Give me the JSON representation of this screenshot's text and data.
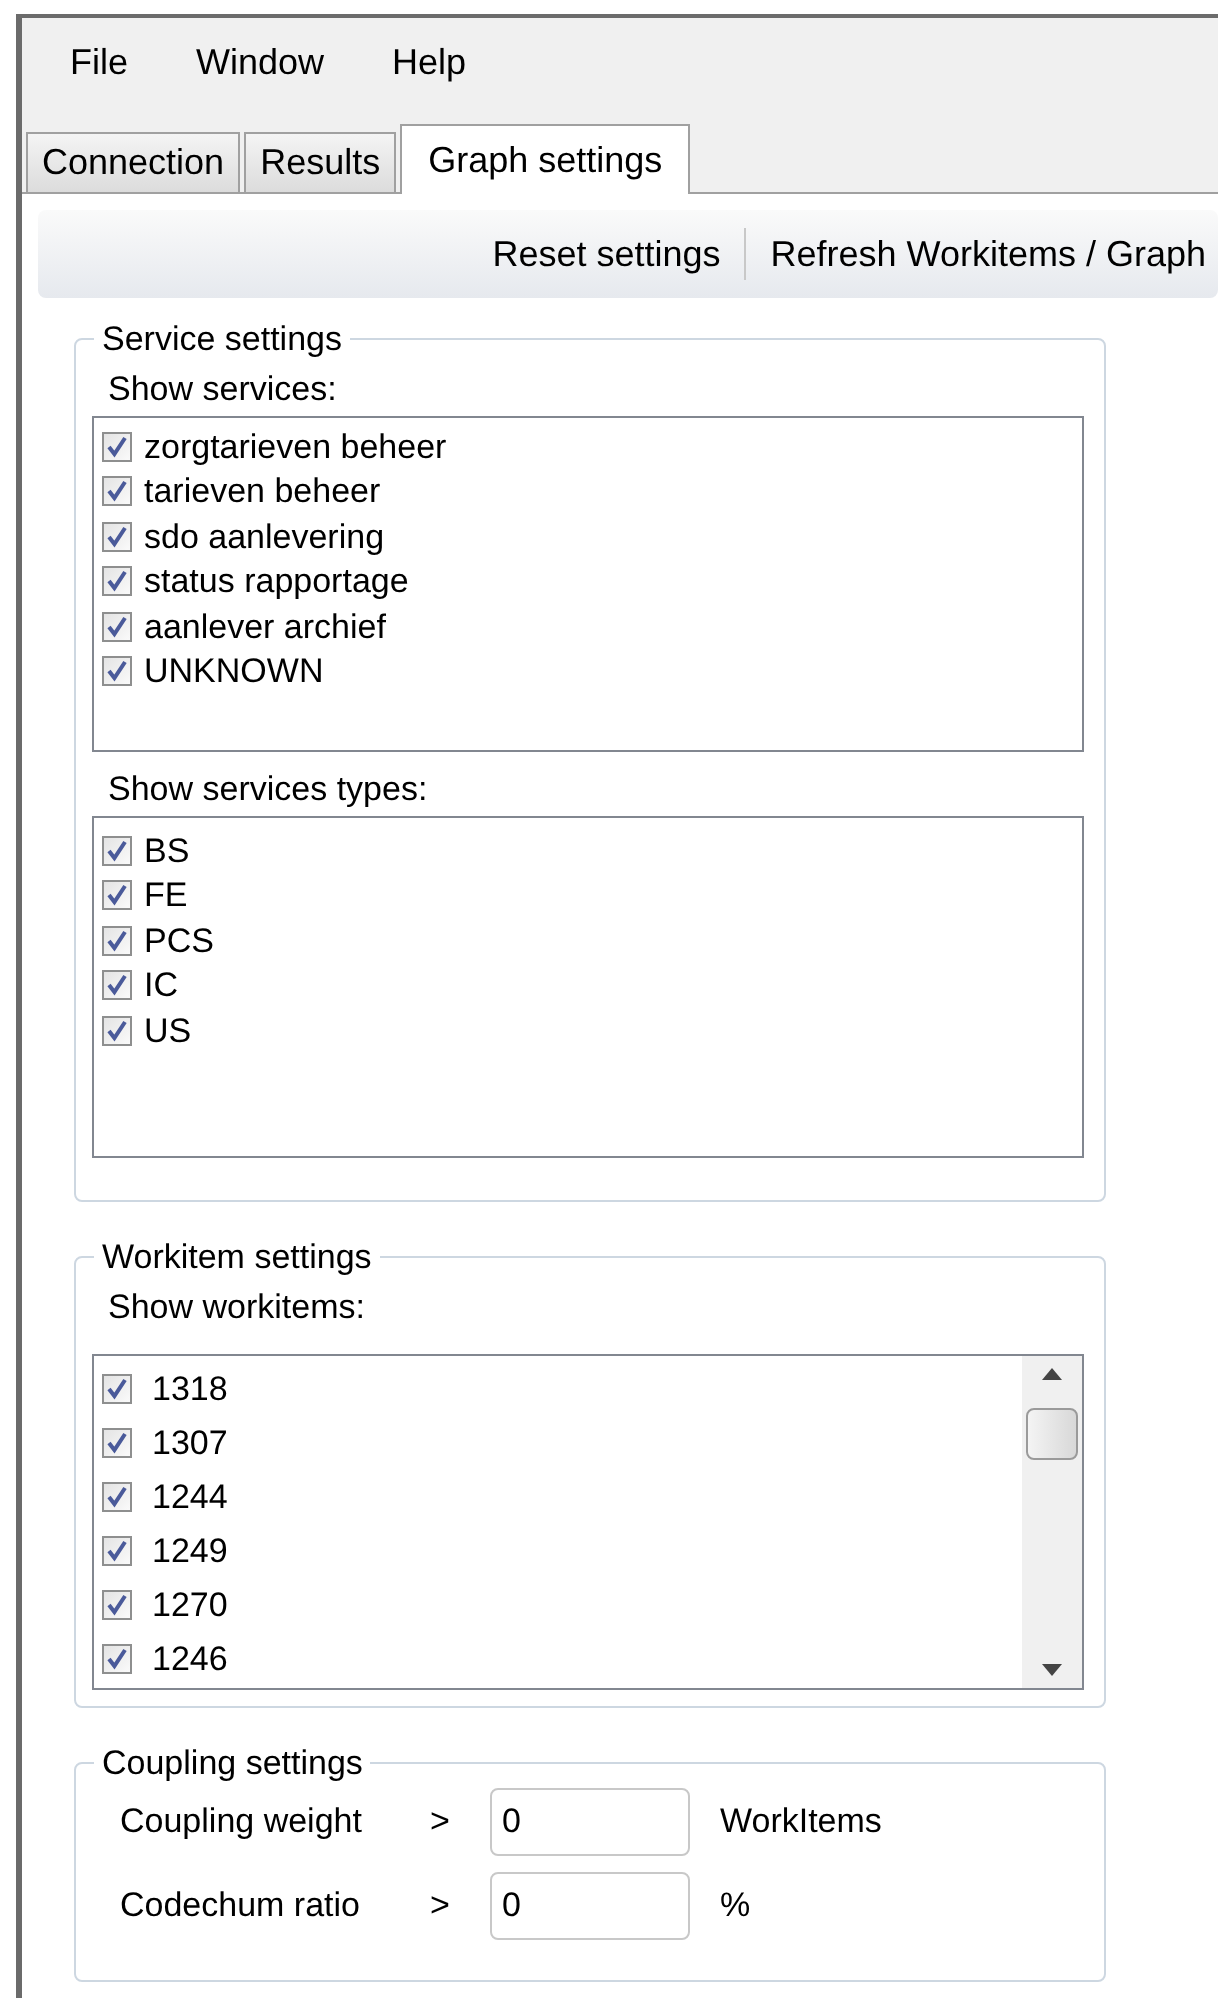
{
  "menu": [
    "File",
    "Window",
    "Help"
  ],
  "tabs": [
    {
      "label": "Connection",
      "selected": false
    },
    {
      "label": "Results",
      "selected": false
    },
    {
      "label": "Graph settings",
      "selected": true
    }
  ],
  "toolbar": [
    "Reset settings",
    "Refresh Workitems / Graph"
  ],
  "service_settings": {
    "title": "Service settings",
    "services_label": "Show services:",
    "services": [
      {
        "label": "zorgtarieven beheer",
        "checked": true
      },
      {
        "label": "tarieven beheer",
        "checked": true
      },
      {
        "label": "sdo aanlevering",
        "checked": true
      },
      {
        "label": "status rapportage",
        "checked": true
      },
      {
        "label": "aanlever archief",
        "checked": true
      },
      {
        "label": "UNKNOWN",
        "checked": true
      }
    ],
    "types_label": "Show services types:",
    "types": [
      {
        "label": "BS",
        "checked": true
      },
      {
        "label": "FE",
        "checked": true
      },
      {
        "label": "PCS",
        "checked": true
      },
      {
        "label": "IC",
        "checked": true
      },
      {
        "label": "US",
        "checked": true
      }
    ]
  },
  "workitem_settings": {
    "title": "Workitem settings",
    "label": "Show workitems:",
    "workitems": [
      {
        "label": "1318",
        "checked": true
      },
      {
        "label": "1307",
        "checked": true
      },
      {
        "label": "1244",
        "checked": true
      },
      {
        "label": "1249",
        "checked": true
      },
      {
        "label": "1270",
        "checked": true
      },
      {
        "label": "1246",
        "checked": true
      }
    ]
  },
  "coupling_settings": {
    "title": "Coupling settings",
    "rows": [
      {
        "label": "Coupling weight",
        "operator": ">",
        "value": "0",
        "unit": "WorkItems"
      },
      {
        "label": "Codechum ratio",
        "operator": ">",
        "value": "0",
        "unit": "%"
      }
    ]
  }
}
